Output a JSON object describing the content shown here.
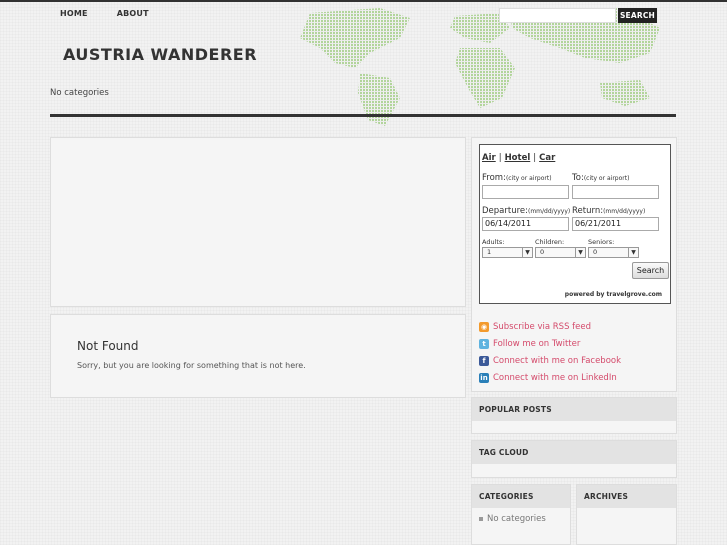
{
  "nav": {
    "items": [
      "HOME",
      "ABOUT"
    ]
  },
  "search": {
    "button": "SEARCH"
  },
  "site": {
    "title": "AUSTRIA WANDERER",
    "header_categories": "No categories"
  },
  "post": {
    "title": "Not Found",
    "text": "Sorry, but you are looking for something that is not here."
  },
  "travel": {
    "tabs": [
      "Air",
      "Hotel",
      "Car"
    ],
    "from_label": "From:",
    "from_hint": "(city or airport)",
    "to_label": "To:",
    "to_hint": "(city or airport)",
    "departure_label": "Departure:",
    "departure_hint": "(mm/dd/yyyy)",
    "departure_value": "06/14/2011",
    "return_label": "Return:",
    "return_hint": "(mm/dd/yyyy)",
    "return_value": "06/21/2011",
    "adults_label": "Adults:",
    "adults_value": "1",
    "children_label": "Children:",
    "children_value": "0",
    "seniors_label": "Seniors:",
    "seniors_value": "0",
    "search_button": "Search",
    "powered": "powered by travelgrove.com"
  },
  "social": [
    {
      "icon": "rss-icon",
      "label": "Subscribe via RSS feed"
    },
    {
      "icon": "twitter-icon",
      "label": "Follow me on Twitter"
    },
    {
      "icon": "facebook-icon",
      "label": "Connect with me on Facebook"
    },
    {
      "icon": "linkedin-icon",
      "label": "Connect with me on LinkedIn"
    }
  ],
  "widgets": {
    "popular": "POPULAR POSTS",
    "tagcloud": "TAG CLOUD",
    "categories": "CATEGORIES",
    "categories_item": "No categories",
    "archives": "ARCHIVES"
  },
  "colors": {
    "link": "#d44a6b",
    "map": "#a8d08d",
    "dark": "#333333"
  }
}
